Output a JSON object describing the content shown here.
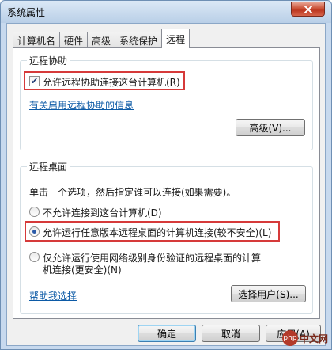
{
  "window": {
    "title": "系统属性"
  },
  "tabs": [
    "计算机名",
    "硬件",
    "高级",
    "系统保护",
    "远程"
  ],
  "remote_assistance": {
    "group_label": "远程协助",
    "checkbox_label": "允许远程协助连接这台计算机(R)",
    "checked": true,
    "info_link": "有关启用远程协助的信息",
    "advanced_button": "高级(V)..."
  },
  "remote_desktop": {
    "group_label": "远程桌面",
    "instruction": "单击一个选项，然后指定谁可以连接(如果需要)。",
    "options": [
      {
        "label": "不允许连接到这台计算机(D)",
        "selected": false
      },
      {
        "label": "允许运行任意版本远程桌面的计算机连接(较不安全)(L)",
        "selected": true
      },
      {
        "label_line1": "仅允许运行使用网络级别身份验证的远程桌面的计算",
        "label_line2": "机连接(更安全)(N)",
        "selected": false
      }
    ],
    "help_link": "帮助我选择",
    "select_users_button": "选择用户(S)..."
  },
  "footer": {
    "ok": "确定",
    "cancel": "取消",
    "apply": "应用(A)"
  },
  "watermark": {
    "badge": "php",
    "text": "中文网"
  },
  "icons": {
    "close": "close-icon",
    "check": "checkmark-icon"
  }
}
